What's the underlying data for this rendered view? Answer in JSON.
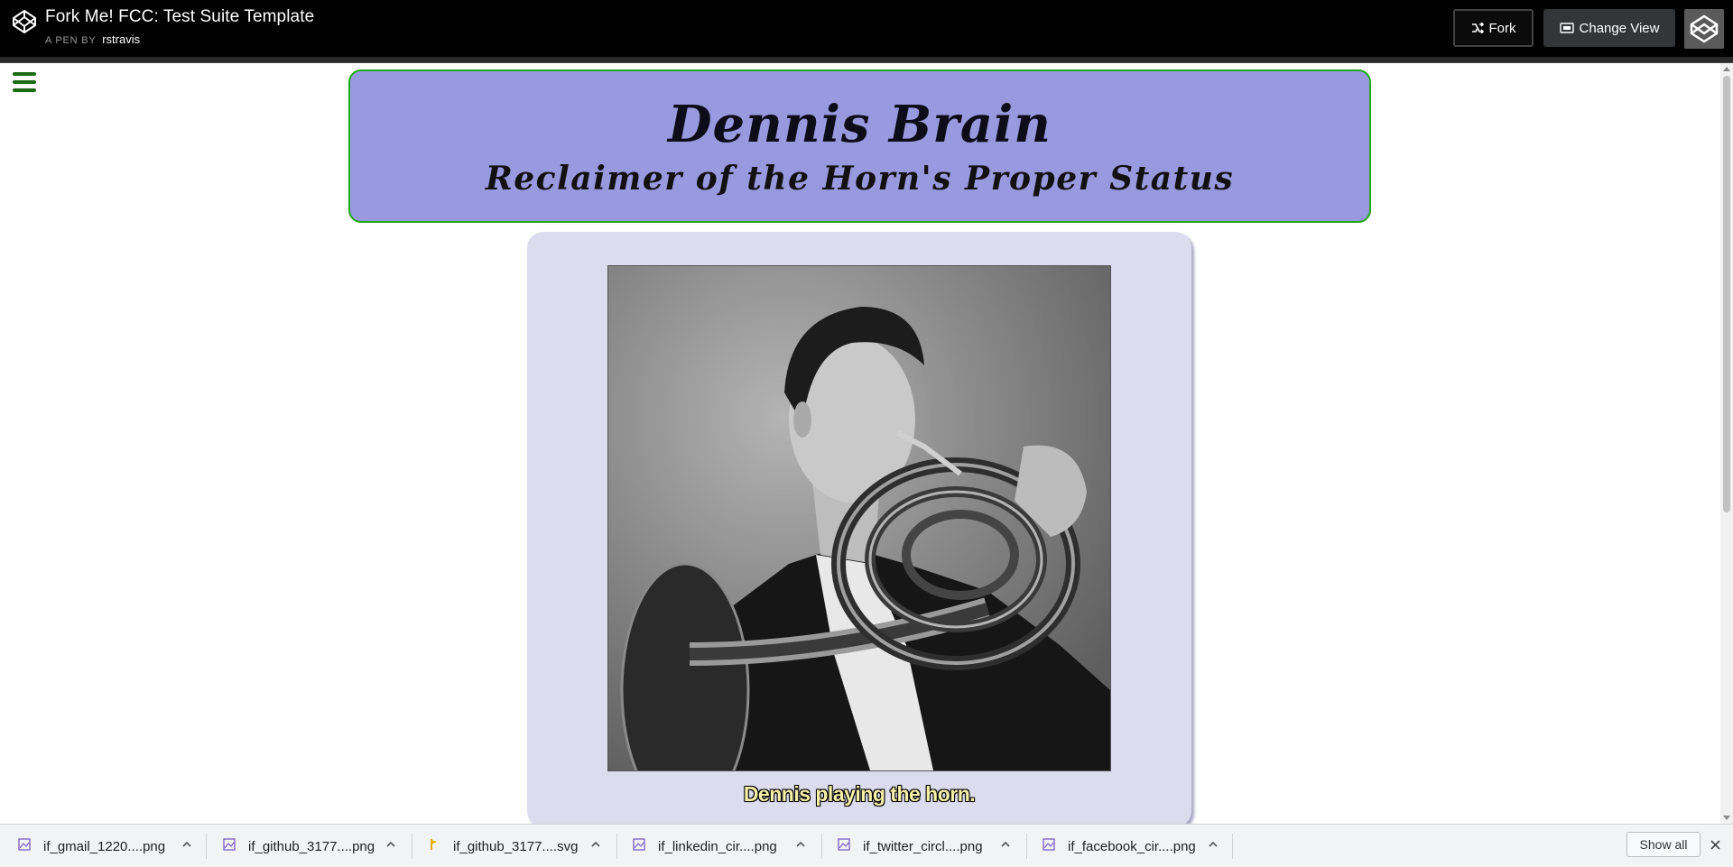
{
  "header": {
    "pen_title": "Fork Me! FCC: Test Suite Template",
    "byline_prefix": "A PEN BY",
    "author": "rstravis",
    "fork_label": "Fork",
    "change_view_label": "Change View"
  },
  "page": {
    "title": "Dennis Brain",
    "subtitle": "Reclaimer of the Horn's Proper Status",
    "image_caption": "Dennis playing the horn."
  },
  "downloads": {
    "items": [
      {
        "name": "if_gmail_1220....png",
        "icon": "image-file-icon"
      },
      {
        "name": "if_github_3177....png",
        "icon": "image-file-icon"
      },
      {
        "name": "if_github_3177....svg",
        "icon": "svg-file-icon"
      },
      {
        "name": "if_linkedin_cir....png",
        "icon": "image-file-icon"
      },
      {
        "name": "if_twitter_circl....png",
        "icon": "image-file-icon"
      },
      {
        "name": "if_facebook_cir....png",
        "icon": "image-file-icon"
      }
    ],
    "show_all_label": "Show all"
  },
  "colors": {
    "header_card_bg": "#9999df",
    "header_card_border": "#22a81c",
    "image_card_bg": "#dddcee",
    "hamburger": "#1a6b12",
    "caption_text": "#f5f1a8"
  }
}
